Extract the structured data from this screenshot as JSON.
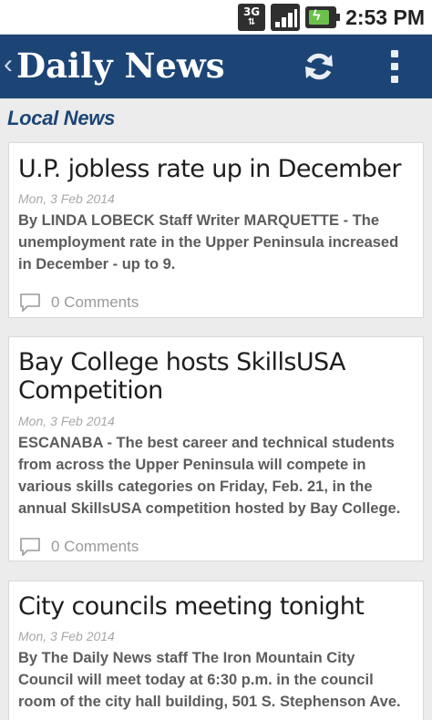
{
  "status_bar": {
    "network": "3G",
    "time": "2:53 PM"
  },
  "app": {
    "title": "Daily News",
    "back_icon": "chevron-left-icon",
    "refresh_icon": "refresh-icon",
    "menu_icon": "overflow-menu-icon",
    "colors": {
      "bar": "#1c4576",
      "section": "#1c4576"
    }
  },
  "section": {
    "title": "Local News"
  },
  "articles": [
    {
      "title": "U.P. jobless rate up in December",
      "date": "Mon, 3 Feb 2014",
      "summary": "By LINDA LOBECK Staff Writer MARQUETTE - The unemployment rate in the Upper Peninsula increased in December - up to 9.",
      "comments": "0 Comments"
    },
    {
      "title": "Bay College hosts SkillsUSA Competition",
      "date": "Mon, 3 Feb 2014",
      "summary": "ESCANABA - The best career and technical students from across the Upper Peninsula will compete in various skills categories on Friday, Feb. 21, in the annual SkillsUSA competition hosted by Bay College.",
      "comments": "0 Comments"
    },
    {
      "title": "City councils meeting tonight",
      "date": "Mon, 3 Feb 2014",
      "summary": "By The Daily News staff The Iron Mountain City Council will meet today at 6:30 p.m. in the council room of the city hall building, 501 S. Stephenson Ave."
    }
  ]
}
